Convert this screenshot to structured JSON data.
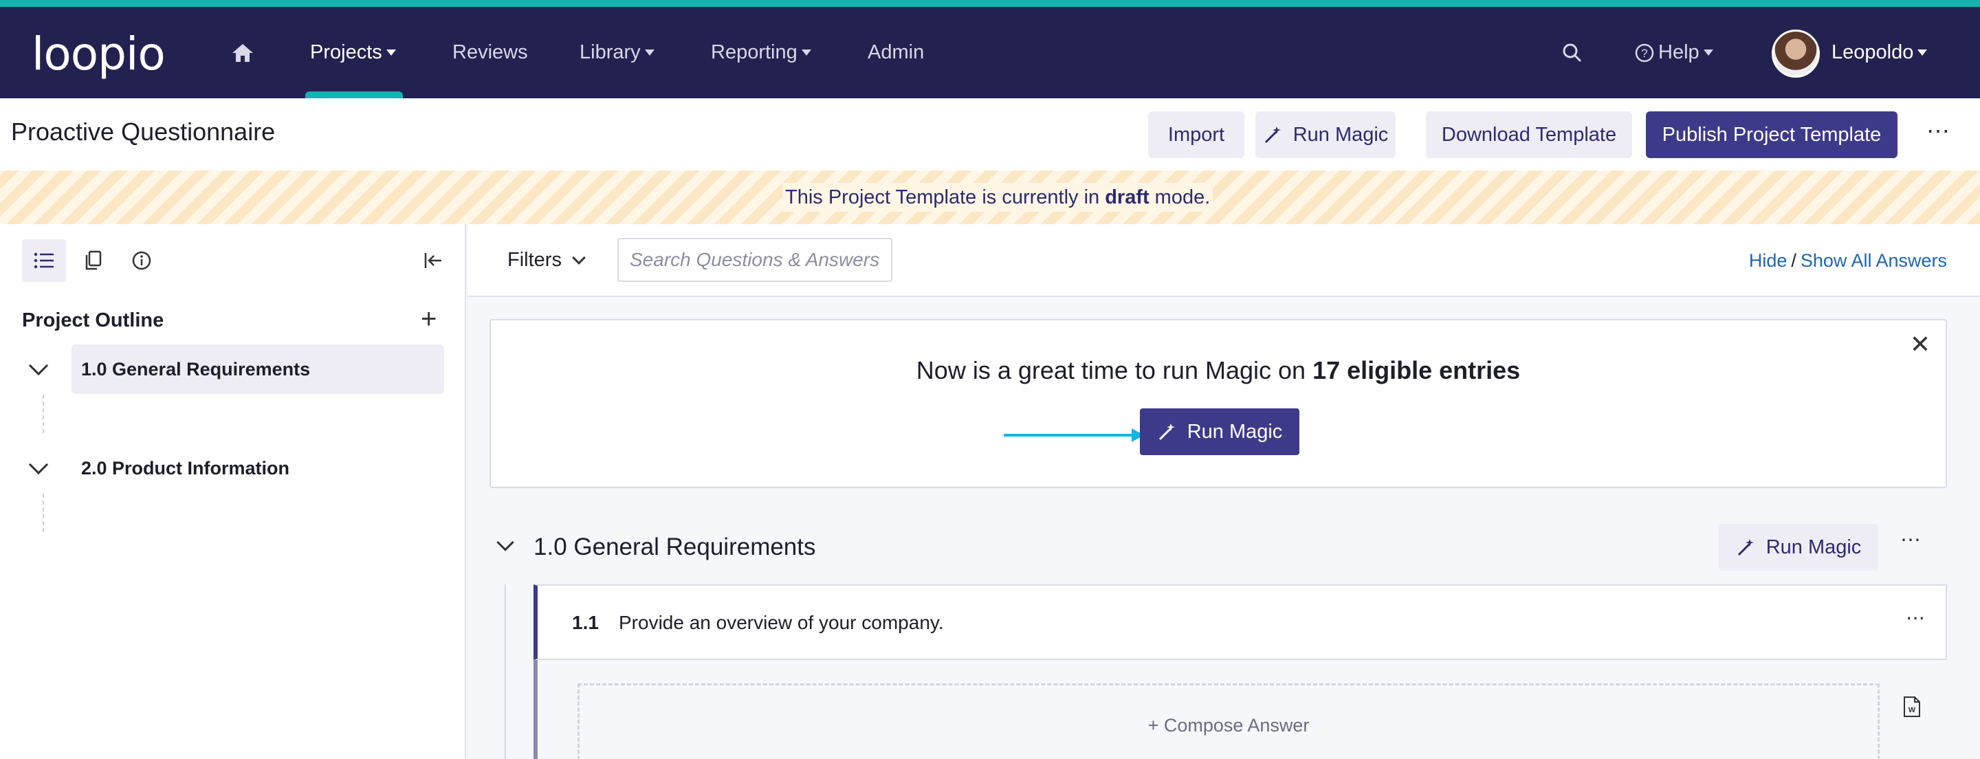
{
  "nav": {
    "logo": "loopio",
    "items": [
      {
        "label": "Projects",
        "dropdown": true,
        "active": true
      },
      {
        "label": "Reviews",
        "dropdown": false
      },
      {
        "label": "Library",
        "dropdown": true
      },
      {
        "label": "Reporting",
        "dropdown": true
      },
      {
        "label": "Admin",
        "dropdown": false
      }
    ],
    "help_label": "Help",
    "user_name": "Leopoldo"
  },
  "header": {
    "title": "Proactive Questionnaire",
    "import_label": "Import",
    "run_magic_label": "Run Magic",
    "download_label": "Download Template",
    "publish_label": "Publish Project Template"
  },
  "banner": {
    "prefix": "This Project Template is currently in",
    "bold": "draft",
    "suffix": "mode."
  },
  "sidebar": {
    "outline_title": "Project Outline",
    "items": [
      {
        "label": "1.0 General Requirements",
        "selected": true
      },
      {
        "label": "2.0 Product Information",
        "selected": false
      }
    ]
  },
  "toolbar": {
    "filters_label": "Filters",
    "search_placeholder": "Search Questions & Answers",
    "hide_label": "Hide",
    "separator": "/",
    "show_all_label": "Show All Answers"
  },
  "magic_card": {
    "message_prefix": "Now is a great time to run Magic on",
    "message_bold": "17 eligible entries",
    "button_label": "Run Magic"
  },
  "section": {
    "title": "1.0 General Requirements",
    "run_magic_label": "Run Magic",
    "question": {
      "number": "1.1",
      "text": "Provide an overview of your company."
    },
    "compose_label": "+ Compose Answer"
  },
  "colors": {
    "nav_bg": "#232150",
    "accent_teal": "#13b3b0",
    "primary": "#3d3a8a",
    "link": "#1e66b3",
    "arrow": "#1ab1e8"
  }
}
